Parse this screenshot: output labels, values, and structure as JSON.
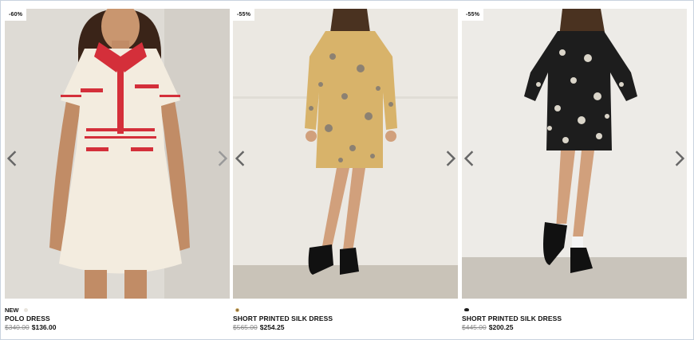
{
  "products": [
    {
      "badge": "-60%",
      "tag": "NEW",
      "swatch_color": "cream",
      "name": "POLO DRESS",
      "old_price": "$340.00",
      "new_price": "$136.00",
      "image_icon": "dress-photo"
    },
    {
      "badge": "-55%",
      "tag": "",
      "swatch_color": "floral",
      "name": "SHORT PRINTED SILK DRESS",
      "old_price": "$565.00",
      "new_price": "$254.25",
      "image_icon": "dress-photo"
    },
    {
      "badge": "-55%",
      "tag": "",
      "swatch_color": "black",
      "name": "SHORT PRINTED SILK DRESS",
      "old_price": "$445.00",
      "new_price": "$200.25",
      "image_icon": "dress-photo"
    }
  ],
  "icons": {
    "prev": "chevron-left-icon",
    "next": "chevron-right-icon"
  }
}
